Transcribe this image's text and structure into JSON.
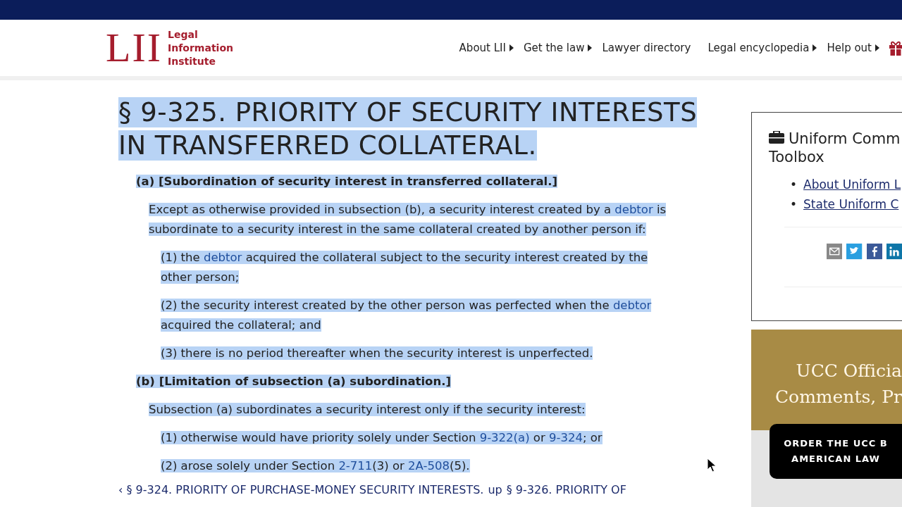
{
  "header": {
    "logo_letters": "LII",
    "logo_text": [
      "Legal",
      "Information",
      "Institute"
    ],
    "nav": [
      {
        "label": "About LII",
        "caret": true
      },
      {
        "label": "Get the law",
        "caret": true
      },
      {
        "label": "Lawyer directory",
        "caret": false
      },
      {
        "label": "Legal encyclopedia",
        "caret": true
      },
      {
        "label": "Help out",
        "caret": true
      }
    ]
  },
  "article": {
    "highlighted": true,
    "title": [
      "§ 9-325. PRIORITY OF SECURITY INTERESTS",
      "IN TRANSFERRED COLLATERAL."
    ],
    "blocks": [
      {
        "kind": "heading",
        "parts": [
          {
            "text": "(a) [Subordination of security interest in transferred collateral.]",
            "link": false
          }
        ]
      },
      {
        "kind": "paragraph",
        "parts": [
          {
            "text": "Except as otherwise provided in subsection (b), a security interest created by a ",
            "link": false
          },
          {
            "text": "debtor",
            "link": true
          },
          {
            "text": " is subordinate to a security interest in the same collateral created by another person if:",
            "link": false
          }
        ]
      },
      {
        "kind": "item",
        "parts": [
          {
            "text": "(1) the ",
            "link": false
          },
          {
            "text": "debtor",
            "link": true
          },
          {
            "text": " acquired the collateral subject to the security interest created by the other person;",
            "link": false
          }
        ]
      },
      {
        "kind": "item",
        "parts": [
          {
            "text": "(2) the security interest created by the other person was perfected when the ",
            "link": false
          },
          {
            "text": "debtor",
            "link": true
          },
          {
            "text": " acquired the collateral; and",
            "link": false
          }
        ]
      },
      {
        "kind": "item",
        "parts": [
          {
            "text": "(3) there is no period thereafter when the security interest is unperfected.",
            "link": false
          }
        ]
      },
      {
        "kind": "heading",
        "parts": [
          {
            "text": "(b) [Limitation of subsection (a) subordination.]",
            "link": false
          }
        ]
      },
      {
        "kind": "paragraph",
        "parts": [
          {
            "text": "Subsection (a) subordinates a security interest only if the security interest:",
            "link": false
          }
        ]
      },
      {
        "kind": "item",
        "parts": [
          {
            "text": "(1) otherwise would have priority solely under Section ",
            "link": false
          },
          {
            "text": "9-322(a)",
            "link": true
          },
          {
            "text": " or ",
            "link": false
          },
          {
            "text": "9-324",
            "link": true
          },
          {
            "text": "; or",
            "link": false
          }
        ]
      },
      {
        "kind": "item",
        "parts": [
          {
            "text": "(2) arose solely under Section ",
            "link": false
          },
          {
            "text": "2-711",
            "link": true
          },
          {
            "text": "(3) or ",
            "link": false
          },
          {
            "text": "2A-508",
            "link": true
          },
          {
            "text": "(5).",
            "link": false
          }
        ]
      }
    ],
    "pager": {
      "prev": "‹ § 9-324. PRIORITY OF PURCHASE-MONEY SECURITY INTERESTS.",
      "up": "up",
      "next": "§ 9-326. PRIORITY OF"
    }
  },
  "sidebar": {
    "toolbox": {
      "title": "Uniform Comm",
      "title_line2": "Toolbox",
      "links": [
        {
          "bullet": "•",
          "text": "About Uniform L"
        },
        {
          "bullet": "•",
          "text": "State Uniform C"
        }
      ]
    },
    "ad": {
      "headline": [
        "UCC Officia",
        "Comments, Pr"
      ],
      "button": [
        "ORDER THE UCC B",
        "AMERICAN LAW"
      ]
    }
  }
}
